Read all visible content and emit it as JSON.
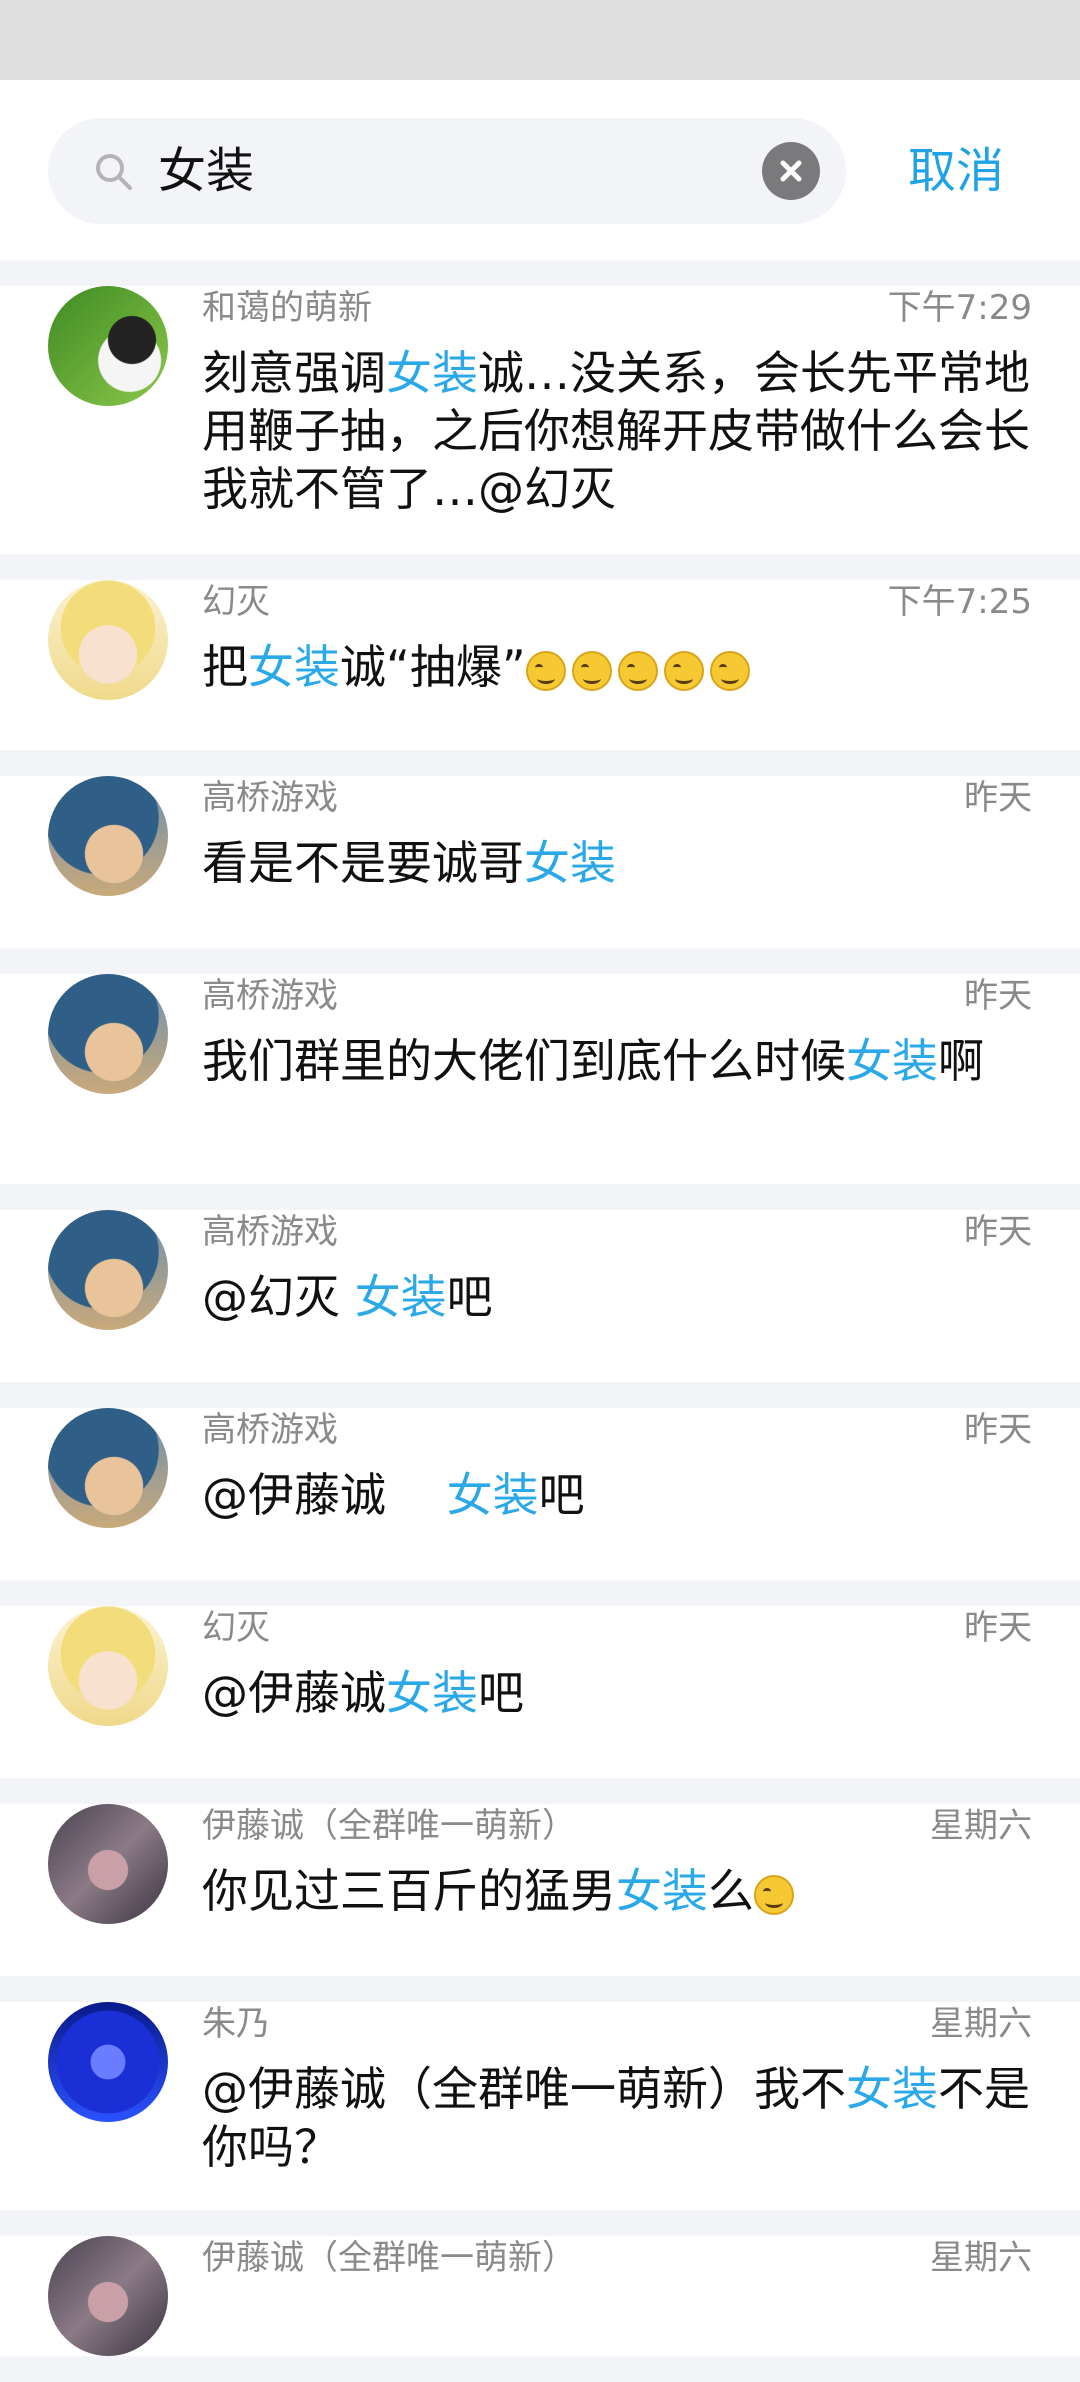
{
  "search": {
    "query": "女装",
    "cancel_label": "取消"
  },
  "messages": [
    {
      "name": "和蔼的萌新",
      "time": "下午7:29",
      "parts": [
        [
          "刻意强调",
          0
        ],
        [
          "女装",
          1
        ],
        [
          "诚…没关系，会长先平常地用鞭子抽，之后你想解开皮带做什么会长我就不管了…@幻灭",
          0
        ]
      ],
      "emojis": 0,
      "avatar": "penguin-avatar"
    },
    {
      "name": "幻灭",
      "time": "下午7:25",
      "parts": [
        [
          "把",
          0
        ],
        [
          "女装",
          1
        ],
        [
          "诚“抽爆”",
          0
        ]
      ],
      "emojis": 5,
      "avatar": "blonde-anime-avatar"
    },
    {
      "name": "高桥游戏",
      "time": "昨天",
      "parts": [
        [
          "看是不是要诚哥",
          0
        ],
        [
          "女装",
          1
        ]
      ],
      "emojis": 0,
      "avatar": "blue-hair-anime-avatar"
    },
    {
      "name": "高桥游戏",
      "time": "昨天",
      "parts": [
        [
          "我们群里的大佬们到底什么时候",
          0
        ],
        [
          "女装",
          1
        ],
        [
          "啊",
          0
        ]
      ],
      "emojis": 0,
      "avatar": "blue-hair-anime-avatar"
    },
    {
      "name": "高桥游戏",
      "time": "昨天",
      "parts": [
        [
          "@幻灭 ",
          0
        ],
        [
          "女装",
          1
        ],
        [
          "吧",
          0
        ]
      ],
      "emojis": 0,
      "avatar": "blue-hair-anime-avatar"
    },
    {
      "name": "高桥游戏",
      "time": "昨天",
      "parts": [
        [
          "@伊藤诚　 ",
          0
        ],
        [
          "女装",
          1
        ],
        [
          "吧",
          0
        ]
      ],
      "emojis": 0,
      "avatar": "blue-hair-anime-avatar"
    },
    {
      "name": "幻灭",
      "time": "昨天",
      "parts": [
        [
          "@伊藤诚",
          0
        ],
        [
          "女装",
          1
        ],
        [
          "吧",
          0
        ]
      ],
      "emojis": 0,
      "avatar": "blonde-anime-avatar"
    },
    {
      "name": "伊藤诚（全群唯一萌新）",
      "time": "星期六",
      "parts": [
        [
          "你见过三百斤的猛男",
          0
        ],
        [
          "女装",
          1
        ],
        [
          "么",
          0
        ]
      ],
      "emojis": 1,
      "avatar": "dark-figure-avatar"
    },
    {
      "name": "朱乃",
      "time": "星期六",
      "parts": [
        [
          "@伊藤诚（全群唯一萌新）我不",
          0
        ],
        [
          "女装",
          1
        ],
        [
          "不是你吗？",
          0
        ]
      ],
      "emojis": 0,
      "avatar": "blue-magician-avatar"
    },
    {
      "name": "伊藤诚（全群唯一萌新）",
      "time": "星期六",
      "parts": [
        [
          "",
          0
        ]
      ],
      "emojis": 0,
      "avatar": "dark-figure-avatar"
    }
  ],
  "colors": {
    "highlight": "#2aa8e8",
    "accent": "#1fa3e6",
    "divider": "#f3f4f8"
  }
}
